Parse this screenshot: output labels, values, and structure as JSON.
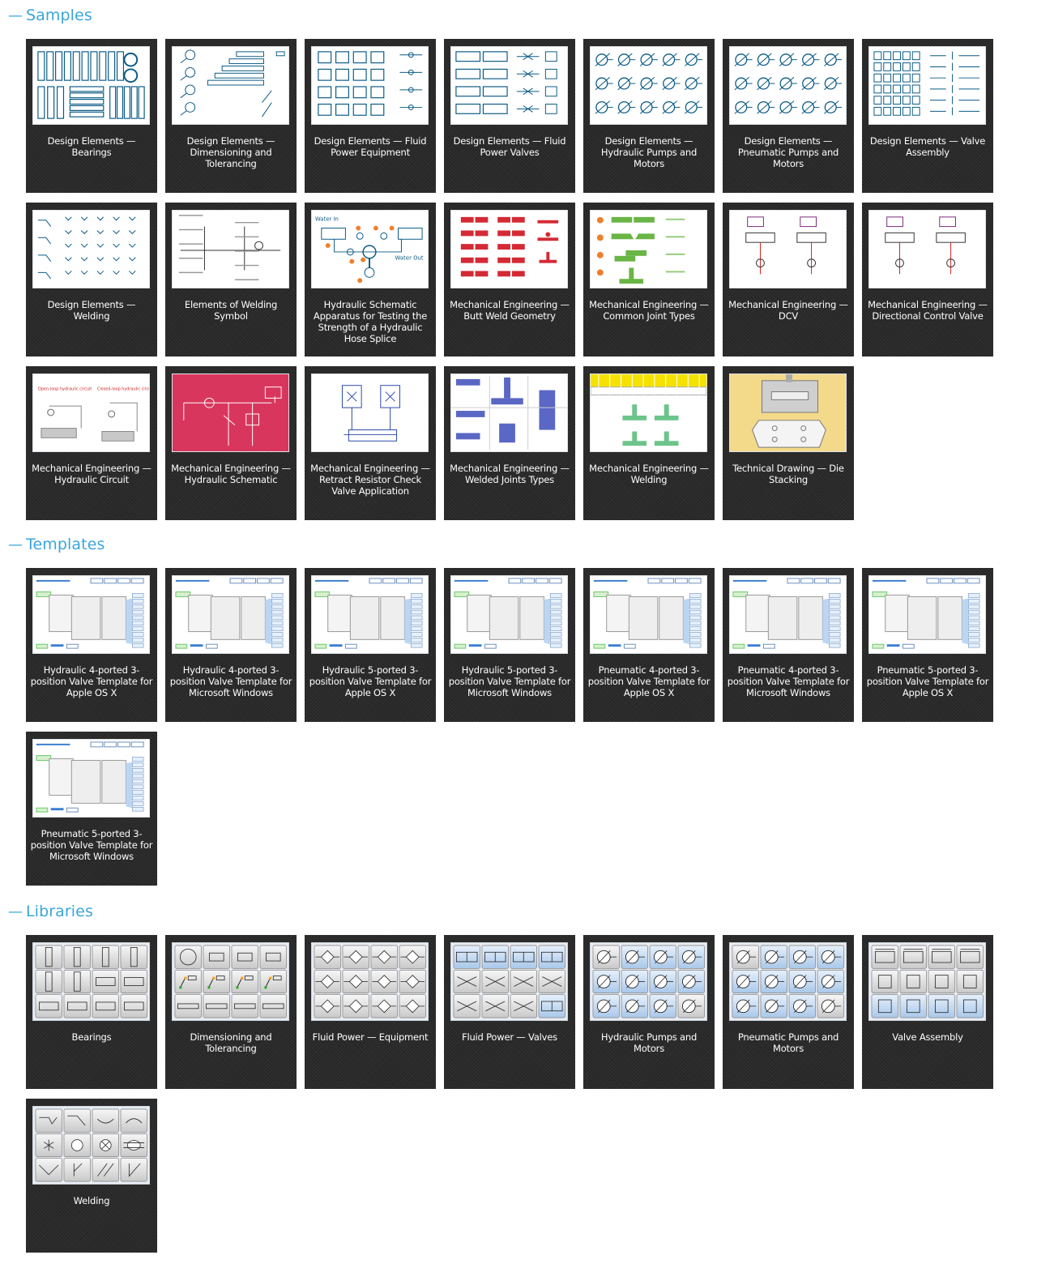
{
  "sections": {
    "samples": {
      "toggle_icon": "minus-icon",
      "title": "Samples",
      "items": [
        {
          "title": "Design Elements — Bearings",
          "thumb": "bearings-drawing"
        },
        {
          "title": "Design Elements — Dimensioning and Tolerancing",
          "thumb": "dimensioning-drawing"
        },
        {
          "title": "Design Elements — Fluid Power Equipment",
          "thumb": "fluid-equipment-drawing"
        },
        {
          "title": "Design Elements — Fluid Power Valves",
          "thumb": "fluid-valves-drawing"
        },
        {
          "title": "Design Elements — Hydraulic Pumps and Motors",
          "thumb": "hydraulic-pumps-drawing"
        },
        {
          "title": "Design Elements — Pneumatic Pumps and Motors",
          "thumb": "pneumatic-pumps-drawing"
        },
        {
          "title": "Design Elements — Valve Assembly",
          "thumb": "valve-assembly-drawing"
        },
        {
          "title": "Design Elements — Welding",
          "thumb": "welding-drawing"
        },
        {
          "title": "Elements of Welding Symbol",
          "thumb": "welding-symbol-drawing"
        },
        {
          "title": "Hydraulic Schematic Apparatus for Testing the Strength of a Hydraulic Hose Splice",
          "thumb": "hose-splice-schematic",
          "labels": [
            "Water In",
            "Water Out"
          ]
        },
        {
          "title": "Mechanical Engineering — Butt Weld Geometry",
          "thumb": "butt-weld-drawing"
        },
        {
          "title": "Mechanical Engineering — Common Joint Types",
          "thumb": "joint-types-drawing"
        },
        {
          "title": "Mechanical Engineering — DCV",
          "thumb": "dcv-drawing"
        },
        {
          "title": "Mechanical Engineering — Directional Control Valve",
          "thumb": "directional-valve-drawing"
        },
        {
          "title": "Mechanical Engineering — Hydraulic Circuit",
          "thumb": "hydraulic-circuit-drawing",
          "labels": [
            "Open-loop hydraulic circuit",
            "Closed-loop hydraulic circuit"
          ]
        },
        {
          "title": "Mechanical Engineering — Hydraulic Schematic",
          "thumb": "hydraulic-schematic-drawing"
        },
        {
          "title": "Mechanical Engineering — Retract Resistor Check Valve Application",
          "thumb": "check-valve-drawing"
        },
        {
          "title": "Mechanical Engineering — Welded Joints Types",
          "thumb": "welded-joints-drawing"
        },
        {
          "title": "Mechanical Engineering — Welding",
          "thumb": "welding-chart-drawing"
        },
        {
          "title": "Technical Drawing — Die Stacking",
          "thumb": "die-stacking-drawing"
        }
      ]
    },
    "templates": {
      "toggle_icon": "minus-icon",
      "title": "Templates",
      "items": [
        {
          "title": "Hydraulic 4-ported 3-position Valve Template for Apple OS X",
          "thumb": "template-screenshot"
        },
        {
          "title": "Hydraulic 4-ported 3-position Valve Template for Microsoft Windows",
          "thumb": "template-screenshot"
        },
        {
          "title": "Hydraulic 5-ported 3-position Valve Template for Apple OS X",
          "thumb": "template-screenshot"
        },
        {
          "title": "Hydraulic 5-ported 3-position Valve Template for Microsoft Windows",
          "thumb": "template-screenshot"
        },
        {
          "title": "Pneumatic 4-ported 3-position Valve Template for Apple OS X",
          "thumb": "template-screenshot"
        },
        {
          "title": "Pneumatic 4-ported 3-position Valve Template for Microsoft Windows",
          "thumb": "template-screenshot"
        },
        {
          "title": "Pneumatic 5-ported 3-position Valve Template for Apple OS X",
          "thumb": "template-screenshot"
        },
        {
          "title": "Pneumatic 5-ported 3-position Valve Template for Microsoft Windows",
          "thumb": "template-screenshot"
        }
      ]
    },
    "libraries": {
      "toggle_icon": "minus-icon",
      "title": "Libraries",
      "items": [
        {
          "title": "Bearings",
          "thumb": "library-icon-grid"
        },
        {
          "title": "Dimensioning and Tolerancing",
          "thumb": "library-icon-grid"
        },
        {
          "title": "Fluid Power — Equipment",
          "thumb": "library-icon-grid"
        },
        {
          "title": "Fluid Power — Valves",
          "thumb": "library-icon-grid"
        },
        {
          "title": "Hydraulic Pumps and Motors",
          "thumb": "library-icon-grid"
        },
        {
          "title": "Pneumatic Pumps and Motors",
          "thumb": "library-icon-grid"
        },
        {
          "title": "Valve Assembly",
          "thumb": "library-icon-grid"
        },
        {
          "title": "Welding",
          "thumb": "library-icon-grid"
        }
      ]
    }
  },
  "colors": {
    "accent": "#3aa5dc",
    "card_bg": "#2b2b2b",
    "card_text": "#ffffff",
    "drawing_blue": "#0a5a85",
    "weld_red": "#d42a35",
    "joint_green": "#69b545",
    "joint_orange": "#ef7f2d",
    "schematic_pink": "#d9365d",
    "welding_yellow": "#f6e200",
    "die_yellow": "#f3d98a"
  }
}
